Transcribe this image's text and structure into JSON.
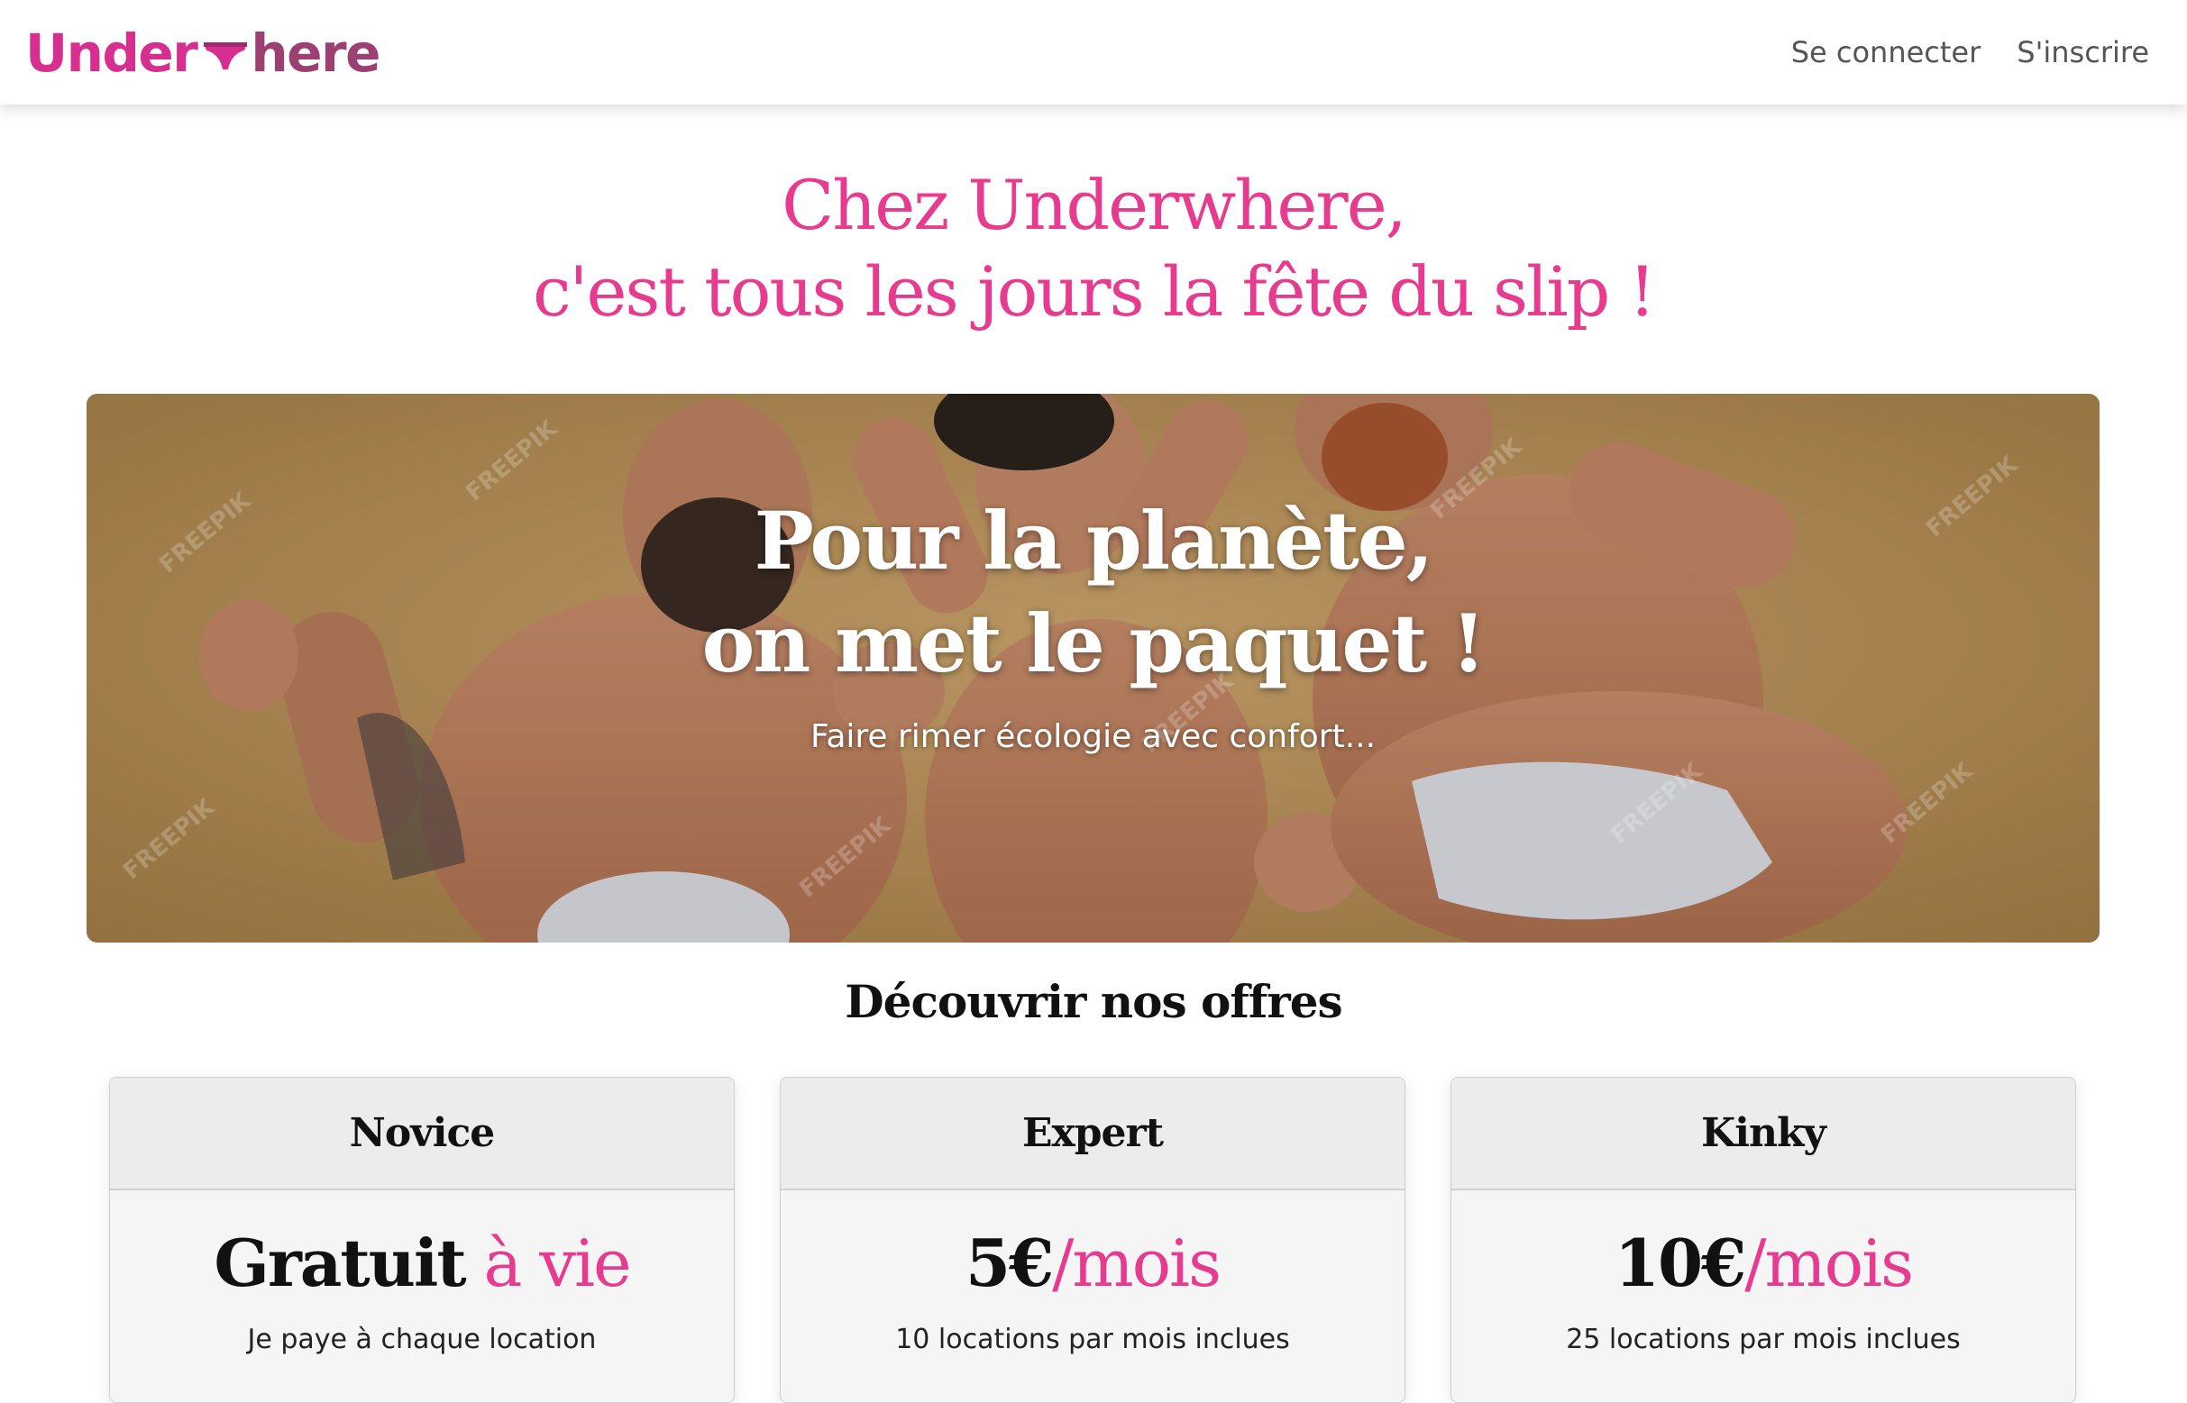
{
  "brand": {
    "logo_part1": "Under",
    "logo_part2": "here",
    "logo_icon": "briefs-icon",
    "primary_color": "#e63b8f",
    "secondary_color": "#9c3f73"
  },
  "nav": {
    "login": "Se connecter",
    "signup": "S'inscrire"
  },
  "hero": {
    "line1": "Chez Underwhere,",
    "line2": "c'est tous les jours la fête du slip !"
  },
  "banner": {
    "title_line1": "Pour la planète,",
    "title_line2": "on met le paquet !",
    "subtitle": "Faire rimer écologie avec confort...",
    "watermark": "FREEPIK"
  },
  "offers": {
    "title": "Découvrir nos offres",
    "plans": [
      {
        "name": "Novice",
        "price": "Gratuit",
        "price_suffix": " à vie",
        "description": "Je paye à chaque location"
      },
      {
        "name": "Expert",
        "price": "5€",
        "price_suffix": "/mois",
        "description": "10 locations par mois inclues"
      },
      {
        "name": "Kinky",
        "price": "10€",
        "price_suffix": "/mois",
        "description": "25 locations par mois inclues"
      }
    ]
  }
}
